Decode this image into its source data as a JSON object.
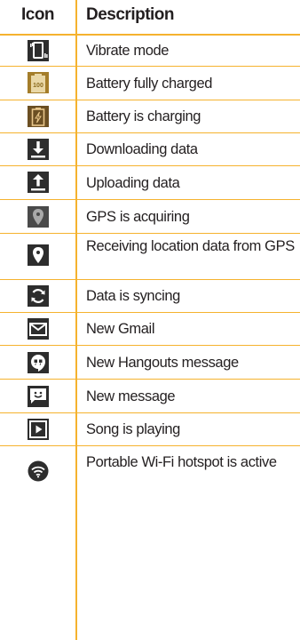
{
  "table": {
    "header": {
      "icon": "Icon",
      "description": "Description"
    },
    "rows": [
      {
        "icon": "vibrate-icon",
        "description": "Vibrate mode"
      },
      {
        "icon": "battery-full-icon",
        "description": "Battery fully charged",
        "icon_text": "100"
      },
      {
        "icon": "battery-charging-icon",
        "description": "Battery is charging"
      },
      {
        "icon": "download-icon",
        "description": "Downloading data"
      },
      {
        "icon": "upload-icon",
        "description": "Uploading data"
      },
      {
        "icon": "gps-acquiring-icon",
        "description": "GPS is acquiring"
      },
      {
        "icon": "gps-location-icon",
        "description": "Receiving location data from GPS"
      },
      {
        "icon": "sync-icon",
        "description": "Data is syncing"
      },
      {
        "icon": "gmail-icon",
        "description": "New Gmail"
      },
      {
        "icon": "hangouts-icon",
        "description": "New Hangouts message"
      },
      {
        "icon": "message-icon",
        "description": "New message"
      },
      {
        "icon": "play-icon",
        "description": "Song is playing"
      },
      {
        "icon": "wifi-hotspot-icon",
        "description": "Portable Wi-Fi hotspot is active"
      }
    ]
  },
  "colors": {
    "rule": "#f5b22e",
    "icon_dark": "#2d2d2d",
    "battery": "#b8860b"
  }
}
